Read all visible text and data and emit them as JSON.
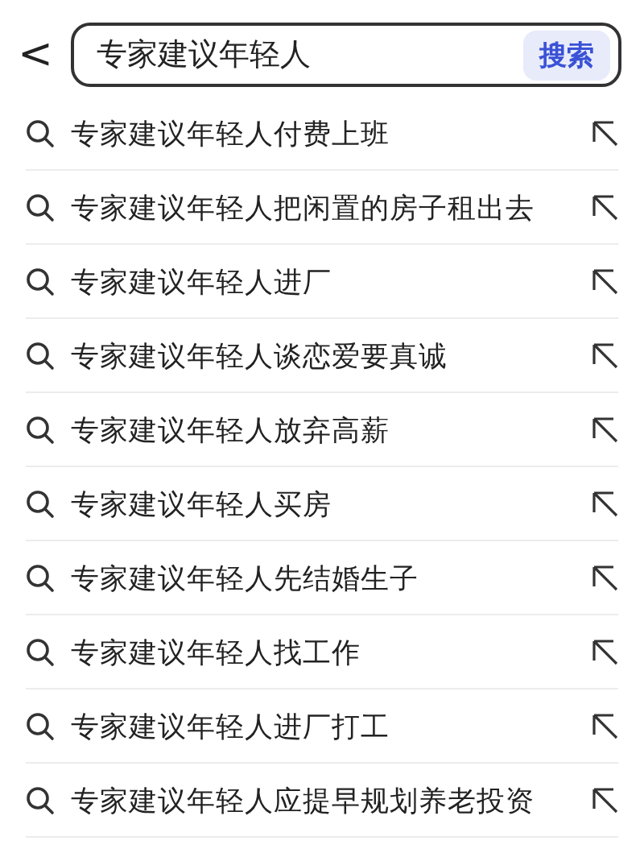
{
  "search_bar": {
    "back_icon": "<",
    "value": "专家建议年轻人",
    "button": "搜索"
  },
  "suggestions": [
    {
      "text": "专家建议年轻人付费上班"
    },
    {
      "text": "专家建议年轻人把闲置的房子租出去"
    },
    {
      "text": "专家建议年轻人进厂"
    },
    {
      "text": "专家建议年轻人谈恋爱要真诚"
    },
    {
      "text": "专家建议年轻人放弃高薪"
    },
    {
      "text": "专家建议年轻人买房"
    },
    {
      "text": "专家建议年轻人先结婚生子"
    },
    {
      "text": "专家建议年轻人找工作"
    },
    {
      "text": "专家建议年轻人进厂打工"
    },
    {
      "text": "专家建议年轻人应提早规划养老投资"
    }
  ]
}
